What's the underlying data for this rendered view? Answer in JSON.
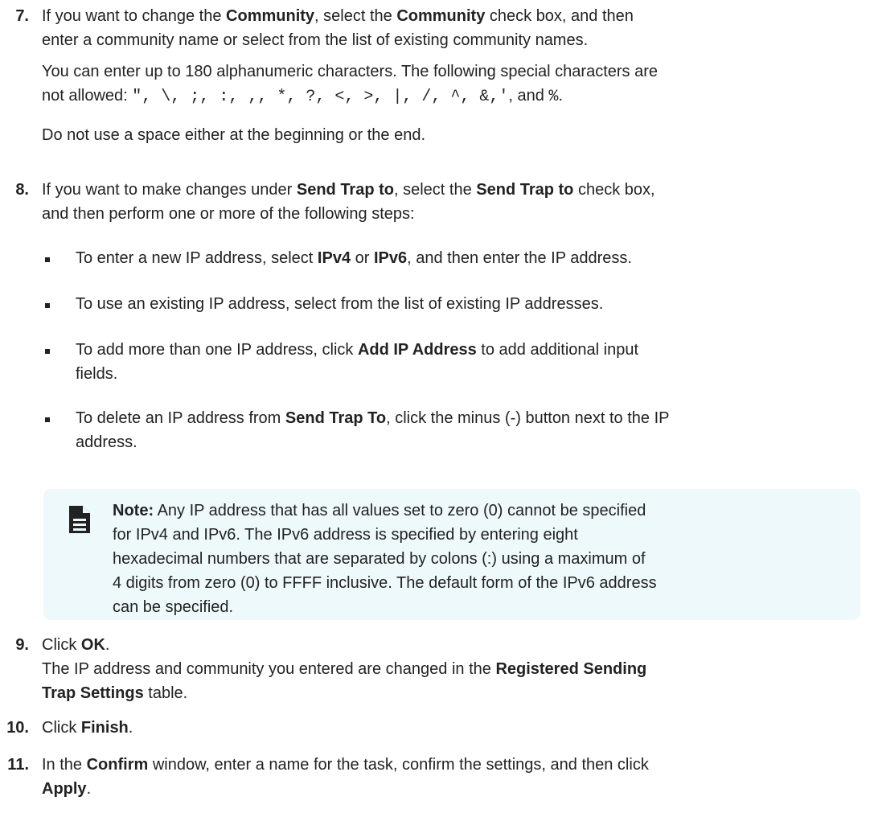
{
  "step7": {
    "num": "7.",
    "l1_a": "If you want to change the ",
    "l1_b": "Community",
    "l1_c": ", select the ",
    "l1_d": "Community",
    "l1_e": " check box, and then",
    "l2": "enter a community name or select from the list of existing community names.",
    "p2_l1": "You can enter up to 180 alphanumeric characters. The following special characters are",
    "p2_l2_prefix": "not allowed: ",
    "p2_l2_chars": "\", \\, ;, :, ,, *, ?, <, >, |, /, ^, &,'",
    "p2_l2_and": ", and ",
    "p2_l2_pct": "%",
    "p2_l2_end": ".",
    "p3": "Do not use a space either at the beginning or the end."
  },
  "step8": {
    "num": "8.",
    "l1_a": "If you want to make changes under ",
    "l1_b": "Send Trap to",
    "l1_c": ", select the ",
    "l1_d": "Send Trap to",
    "l1_e": " check box,",
    "l2": "and then perform one or more of the following steps:",
    "bullets": {
      "b1": {
        "a": "To enter a new IP address, select ",
        "b": "IPv4",
        "c": " or ",
        "d": "IPv6",
        "e": ", and then enter the IP address."
      },
      "b2": {
        "a": "To use an existing IP address, select from the list of existing IP addresses."
      },
      "b3": {
        "a": "To add more than one IP address, click ",
        "b": "Add IP Address",
        "c": " to add additional input",
        "d": "fields."
      },
      "b4": {
        "a": "To delete an IP address from ",
        "b": "Send Trap To",
        "c": ", click the minus (-) button next to the IP",
        "d": "address."
      }
    }
  },
  "note": {
    "icon": "note-document-icon",
    "label": "Note:",
    "l1": " Any IP address that has all values set to zero (0) cannot be specified",
    "l2": "for IPv4 and IPv6. The IPv6 address is specified by entering eight",
    "l3": "hexadecimal numbers that are separated by colons (:) using a maximum of",
    "l4": "4 digits from zero (0) to FFFF inclusive. The default form of the IPv6 address",
    "l5": "can be specified.",
    "bg_color": "#eef9fc"
  },
  "step9": {
    "num": "9.",
    "l1_a": "Click ",
    "l1_b": "OK",
    "l1_c": ".",
    "l2_a": "The IP address and community you entered are changed in the ",
    "l2_b": "Registered Sending",
    "l3_b": "Trap Settings",
    "l3_c": " table."
  },
  "step10": {
    "num": "10.",
    "a": "Click ",
    "b": "Finish",
    "c": "."
  },
  "step11": {
    "num": "11.",
    "l1_a": "In the ",
    "l1_b": "Confirm",
    "l1_c": " window, enter a name for the task, confirm the settings, and then click",
    "l2_b": "Apply",
    "l2_c": "."
  }
}
